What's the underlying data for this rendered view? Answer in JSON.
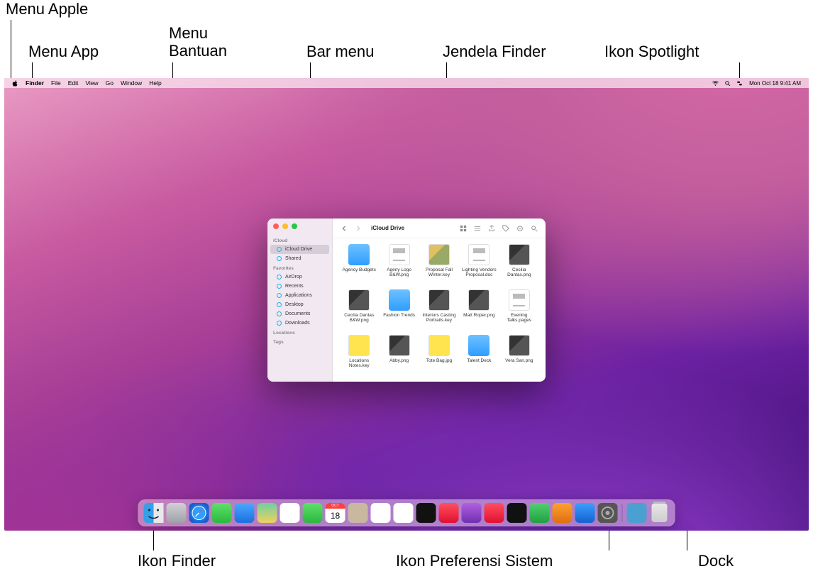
{
  "annotations": {
    "apple_menu": "Menu Apple",
    "app_menu": "Menu App",
    "help_menu": "Menu\nBantuan",
    "menu_bar": "Bar menu",
    "finder_window": "Jendela Finder",
    "spotlight_icon": "Ikon Spotlight",
    "finder_icon": "Ikon Finder",
    "syspref_icon": "Ikon Preferensi Sistem",
    "dock": "Dock"
  },
  "menubar": {
    "app": "Finder",
    "items": [
      "File",
      "Edit",
      "View",
      "Go",
      "Window",
      "Help"
    ],
    "clock": "Mon Oct 18  9:41 AM"
  },
  "finder": {
    "title": "iCloud Drive",
    "sidebar": {
      "sections": [
        {
          "heading": "iCloud",
          "items": [
            {
              "label": "iCloud Drive",
              "icon": "cloud",
              "sel": true
            },
            {
              "label": "Shared",
              "icon": "folder-shared",
              "sel": false
            }
          ]
        },
        {
          "heading": "Favorites",
          "items": [
            {
              "label": "AirDrop",
              "icon": "airdrop"
            },
            {
              "label": "Recents",
              "icon": "clock"
            },
            {
              "label": "Applications",
              "icon": "apps"
            },
            {
              "label": "Desktop",
              "icon": "desktop"
            },
            {
              "label": "Documents",
              "icon": "doc"
            },
            {
              "label": "Downloads",
              "icon": "download"
            }
          ]
        },
        {
          "heading": "Locations",
          "items": []
        },
        {
          "heading": "Tags",
          "items": []
        }
      ]
    },
    "files": [
      {
        "label": "Agency Budgets",
        "type": "folder"
      },
      {
        "label": "Ageny Logo B&W.png",
        "type": "doc"
      },
      {
        "label": "Proposal Fall Winter.key",
        "type": "img2"
      },
      {
        "label": "Lighting Vendors Proposal.doc",
        "type": "doc"
      },
      {
        "label": "Cecilia Dantas.png",
        "type": "img"
      },
      {
        "label": "Cecilia Dantas B&W.png",
        "type": "img"
      },
      {
        "label": "Fashion Trends",
        "type": "folder"
      },
      {
        "label": "Interiors Casting Portraits.key",
        "type": "img"
      },
      {
        "label": "Matt Roper.png",
        "type": "img"
      },
      {
        "label": "Evening Talks.pages",
        "type": "doc"
      },
      {
        "label": "Locations Notes.key",
        "type": "yellow"
      },
      {
        "label": "Abby.png",
        "type": "img"
      },
      {
        "label": "Tote Bag.jpg",
        "type": "yellow"
      },
      {
        "label": "Talent Deck",
        "type": "folder"
      },
      {
        "label": "Vera San.png",
        "type": "img"
      }
    ]
  },
  "dock": {
    "apps": [
      {
        "name": "Finder",
        "bg": "linear-gradient(#4ab7ff,#1e6fe0)"
      },
      {
        "name": "Launchpad",
        "bg": "linear-gradient(#d0d0d5,#a0a0a8)"
      },
      {
        "name": "Safari",
        "bg": "linear-gradient(#3aa0ff,#1560d0)"
      },
      {
        "name": "Messages",
        "bg": "linear-gradient(#5fe06a,#2bb93f)"
      },
      {
        "name": "Mail",
        "bg": "linear-gradient(#4aa8ff,#1d6fe0)"
      },
      {
        "name": "Maps",
        "bg": "linear-gradient(#6fd0a0,#f0d060)"
      },
      {
        "name": "Photos",
        "bg": "#fff"
      },
      {
        "name": "FaceTime",
        "bg": "linear-gradient(#5fe06a,#2bb93f)"
      },
      {
        "name": "Calendar",
        "bg": "#fff"
      },
      {
        "name": "Contacts",
        "bg": "#c8b8a0"
      },
      {
        "name": "Reminders",
        "bg": "#fff"
      },
      {
        "name": "Notes",
        "bg": "#fff"
      },
      {
        "name": "TV",
        "bg": "#111"
      },
      {
        "name": "Music",
        "bg": "linear-gradient(#ff5060,#e01030)"
      },
      {
        "name": "Podcasts",
        "bg": "linear-gradient(#b060e0,#7030b0)"
      },
      {
        "name": "News",
        "bg": "linear-gradient(#ff5060,#e01030)"
      },
      {
        "name": "Stocks",
        "bg": "#111"
      },
      {
        "name": "Numbers",
        "bg": "linear-gradient(#50d070,#20a040)"
      },
      {
        "name": "Pages",
        "bg": "linear-gradient(#ffa030,#e07010)"
      },
      {
        "name": "AppStore",
        "bg": "linear-gradient(#3aa0ff,#1560d0)"
      },
      {
        "name": "SystemPreferences",
        "bg": "#555"
      }
    ],
    "recent": [
      {
        "name": "Downloads",
        "bg": "#4aa0d0"
      }
    ]
  },
  "calendar_day": "18"
}
